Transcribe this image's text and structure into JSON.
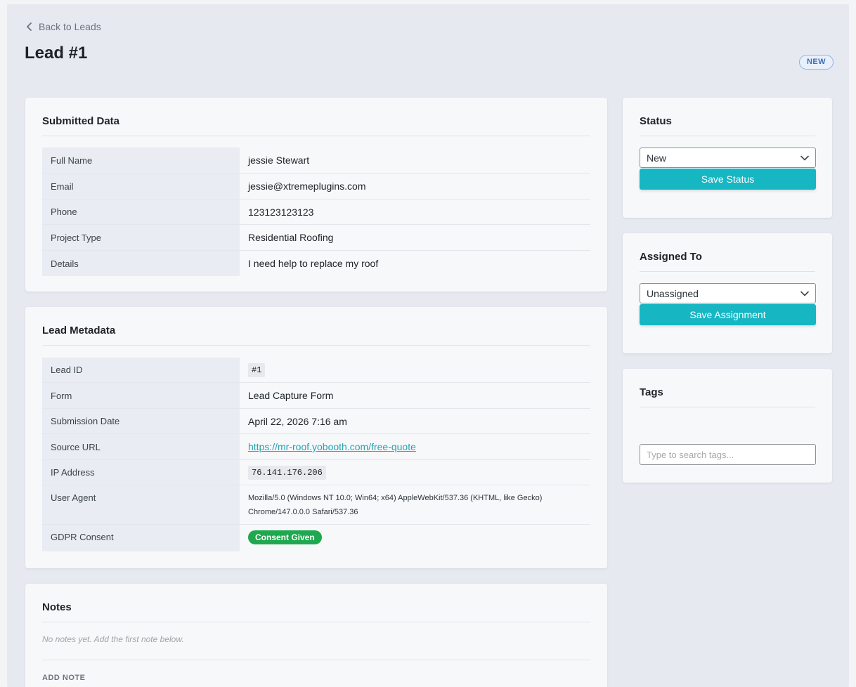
{
  "header": {
    "back_label": "Back to Leads",
    "title": "Lead #1",
    "status_badge": "NEW"
  },
  "submitted": {
    "title": "Submitted Data",
    "rows": [
      {
        "key": "Full Name",
        "value": "jessie Stewart"
      },
      {
        "key": "Email",
        "value": "jessie@xtremeplugins.com"
      },
      {
        "key": "Phone",
        "value": "123123123123"
      },
      {
        "key": "Project Type",
        "value": "Residential Roofing"
      },
      {
        "key": "Details",
        "value": "I need help to replace my roof"
      }
    ]
  },
  "metadata": {
    "title": "Lead Metadata",
    "lead_id_key": "Lead ID",
    "lead_id": "#1",
    "form_key": "Form",
    "form": "Lead Capture Form",
    "date_key": "Submission Date",
    "date": "April 22, 2026 7:16 am",
    "source_key": "Source URL",
    "source_url": "https://mr-roof.yobooth.com/free-quote",
    "ip_key": "IP Address",
    "ip": "76.141.176.206",
    "ua_key": "User Agent",
    "user_agent_line1": "Mozilla/5.0 (Windows NT 10.0; Win64; x64) AppleWebKit/537.36 (KHTML, like Gecko)",
    "user_agent_line2": "Chrome/147.0.0.0 Safari/537.36",
    "gdpr_key": "GDPR Consent",
    "gdpr": "Consent Given"
  },
  "notes": {
    "title": "Notes",
    "empty_text": "No notes yet. Add the first note below.",
    "add_label": "ADD NOTE"
  },
  "status_card": {
    "title": "Status",
    "selected": "New",
    "save_label": "Save Status"
  },
  "assigned_card": {
    "title": "Assigned To",
    "selected": "Unassigned",
    "save_label": "Save Assignment"
  },
  "tags_card": {
    "title": "Tags",
    "placeholder": "Type to search tags..."
  },
  "colors": {
    "accent": "#16b6c3",
    "consent": "#1fa84f",
    "link": "#1fa5b2"
  }
}
